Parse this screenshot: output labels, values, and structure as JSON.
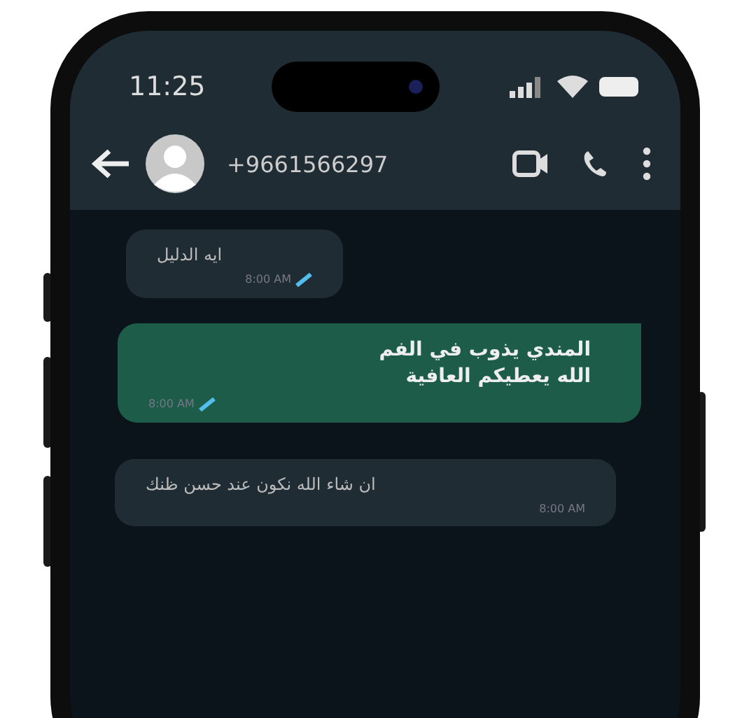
{
  "status_bar": {
    "time": "11:25"
  },
  "header": {
    "contact": "+9661566297"
  },
  "messages": [
    {
      "kind": "incoming",
      "text": "ايه الدليل",
      "time": "8:00 AM",
      "read": true
    },
    {
      "kind": "outgoing",
      "text": "المندي يذوب في الفم\nالله يعطيكم العافية",
      "time": "8:00 AM",
      "read": true
    },
    {
      "kind": "incoming",
      "text": "ان شاء الله نكون عند حسن ظنك",
      "time": "8:00 AM",
      "read": false
    }
  ]
}
